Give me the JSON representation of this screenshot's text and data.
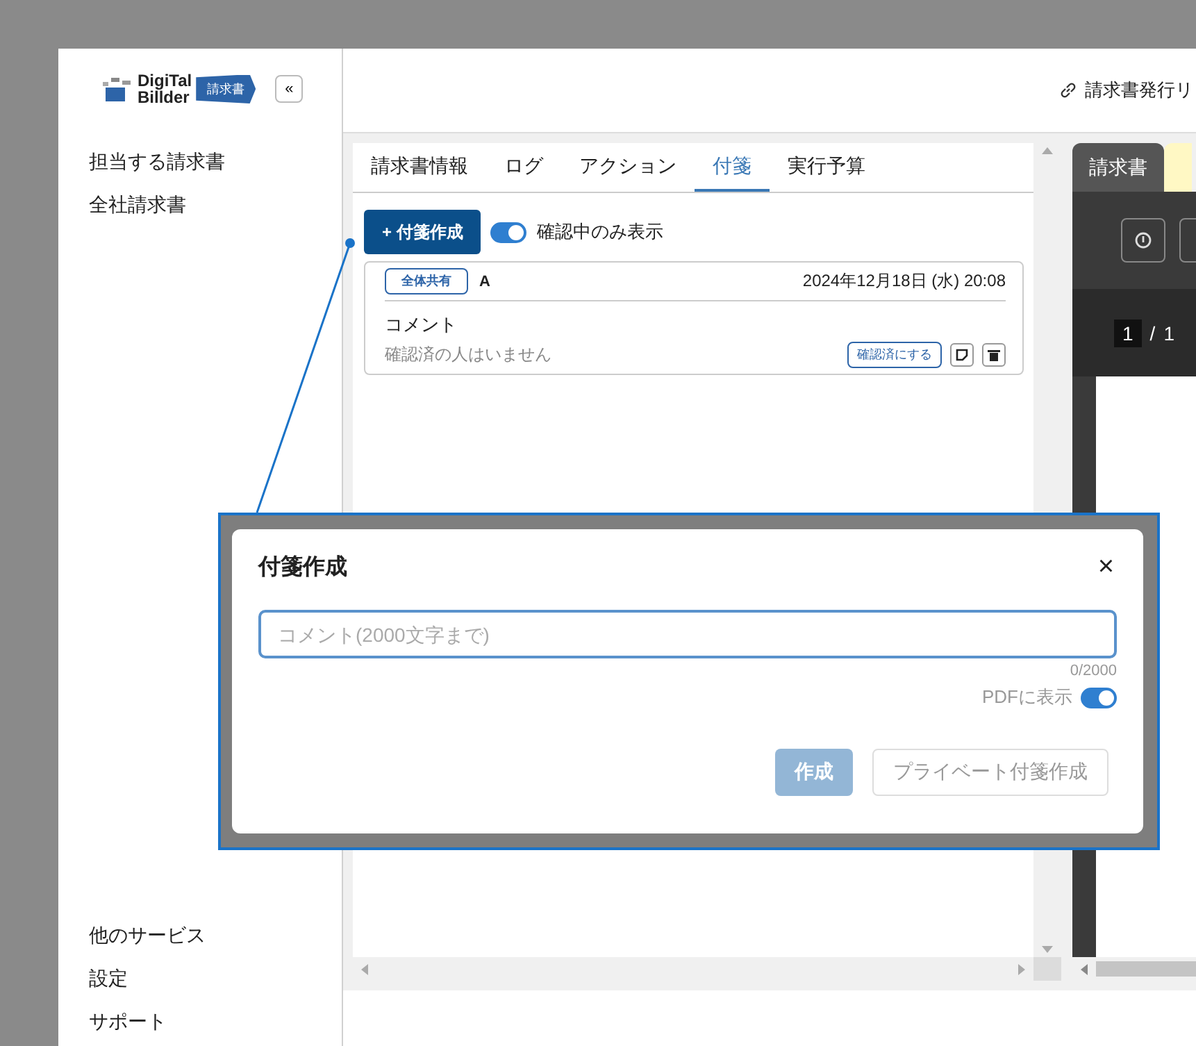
{
  "sidebar": {
    "logo": {
      "line1": "DigiTal",
      "line2": "Billder",
      "badge": "請求書"
    },
    "collapse_button": "«",
    "items": [
      {
        "label": "担当する請求書"
      },
      {
        "label": "全社請求書"
      }
    ],
    "footer_items": [
      {
        "label": "他のサービス"
      },
      {
        "label": "設定"
      },
      {
        "label": "サポート"
      }
    ]
  },
  "header": {
    "link": "請求書発行リ"
  },
  "detail_panel": {
    "tabs": [
      {
        "label": "請求書情報",
        "selected": false
      },
      {
        "label": "ログ",
        "selected": false
      },
      {
        "label": "アクション",
        "selected": false
      },
      {
        "label": "付箋",
        "selected": true
      },
      {
        "label": "実行予算",
        "selected": false
      }
    ],
    "add_note_button": "+ 付箋作成",
    "filter_toggle": {
      "label": "確認中のみ表示",
      "on": true
    },
    "notes": [
      {
        "scope": "全体共有",
        "author": "A",
        "date": "2024年12月18日 (水) 20:08",
        "body": "コメント",
        "confirmed_by": "確認済の人はいません",
        "confirm_button": "確認済にする"
      }
    ]
  },
  "viewer": {
    "tabs": [
      {
        "label": "請求書",
        "selected": true
      }
    ],
    "page_indicator": {
      "current": "1",
      "separator": "/",
      "total": "1"
    }
  },
  "dialog": {
    "title": "付箋作成",
    "close": "×",
    "comment": {
      "placeholder": "コメント(2000文字まで)"
    },
    "counter": "0/2000",
    "pdf_toggle": {
      "label": "PDFに表示",
      "on": true
    },
    "buttons": [
      {
        "label": "作成",
        "kind": "primary",
        "disabled": true
      },
      {
        "label": "プライベート付箋作成",
        "kind": "secondary",
        "disabled": true
      }
    ]
  }
}
